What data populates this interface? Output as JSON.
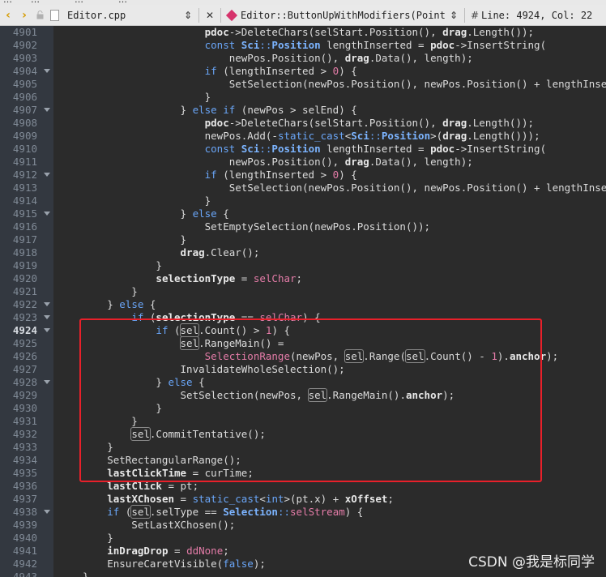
{
  "menubar": {
    "items": [
      "…",
      "…",
      "…",
      "…"
    ]
  },
  "toolbar": {
    "back_icon": "chevron-left-icon",
    "forward_icon": "chevron-right-icon",
    "file_name": "Editor.cpp",
    "file_switch_glyph": "⇕",
    "close_glyph": "✕",
    "function_name": "Editor::ButtonUpWithModifiers(Point, u",
    "function_switch_glyph": "⇕",
    "hash_glyph": "#",
    "line_info": "Line: 4924, Col: 22"
  },
  "colors": {
    "background": "#2b2b2b",
    "gutter": "#333840",
    "keyword": "#6aa6f8",
    "number": "#e47ca8",
    "annotation_box": "#e8202a"
  },
  "editor": {
    "current_line": "4924",
    "lines": [
      {
        "n": "4901",
        "fold": false,
        "t": [
          [
            "                        ",
            ""
          ],
          [
            "pdoc",
            "mb"
          ],
          [
            "->DeleteChars(selStart.Position(), ",
            ""
          ],
          [
            "drag",
            "mb"
          ],
          [
            ".Length());",
            ""
          ]
        ]
      },
      {
        "n": "4902",
        "fold": false,
        "t": [
          [
            "                        ",
            ""
          ],
          [
            "const ",
            "kw"
          ],
          [
            "Sci",
            "ty"
          ],
          [
            "::",
            "kw"
          ],
          [
            "Position",
            "ty"
          ],
          [
            " lengthInserted = ",
            ""
          ],
          [
            "pdoc",
            "mb"
          ],
          [
            "->InsertString(",
            ""
          ]
        ]
      },
      {
        "n": "4903",
        "fold": false,
        "t": [
          [
            "                            newPos.Position(), ",
            ""
          ],
          [
            "drag",
            "mb"
          ],
          [
            ".Data(), length);",
            ""
          ]
        ]
      },
      {
        "n": "4904",
        "fold": true,
        "t": [
          [
            "                        ",
            ""
          ],
          [
            "if ",
            "kw"
          ],
          [
            "(lengthInserted > ",
            ""
          ],
          [
            "0",
            "nu"
          ],
          [
            ") {",
            ""
          ]
        ]
      },
      {
        "n": "4905",
        "fold": false,
        "t": [
          [
            "                            SetSelection(newPos.Position(), newPos.Position() + lengthInserted);",
            ""
          ]
        ]
      },
      {
        "n": "4906",
        "fold": false,
        "t": [
          [
            "                        }",
            ""
          ]
        ]
      },
      {
        "n": "4907",
        "fold": true,
        "t": [
          [
            "                    } ",
            ""
          ],
          [
            "else if ",
            "kw"
          ],
          [
            "(newPos > selEnd) {",
            ""
          ]
        ]
      },
      {
        "n": "4908",
        "fold": false,
        "t": [
          [
            "                        ",
            ""
          ],
          [
            "pdoc",
            "mb"
          ],
          [
            "->DeleteChars(selStart.Position(), ",
            ""
          ],
          [
            "drag",
            "mb"
          ],
          [
            ".Length());",
            ""
          ]
        ]
      },
      {
        "n": "4909",
        "fold": false,
        "t": [
          [
            "                        newPos.Add(-",
            ""
          ],
          [
            "static_cast",
            "kw"
          ],
          [
            "<",
            ""
          ],
          [
            "Sci",
            "ty"
          ],
          [
            "::",
            "kw"
          ],
          [
            "Position",
            "ty"
          ],
          [
            ">(",
            ""
          ],
          [
            "drag",
            "mb"
          ],
          [
            ".Length()));",
            ""
          ]
        ]
      },
      {
        "n": "4910",
        "fold": false,
        "t": [
          [
            "                        ",
            ""
          ],
          [
            "const ",
            "kw"
          ],
          [
            "Sci",
            "ty"
          ],
          [
            "::",
            "kw"
          ],
          [
            "Position",
            "ty"
          ],
          [
            " lengthInserted = ",
            ""
          ],
          [
            "pdoc",
            "mb"
          ],
          [
            "->InsertString(",
            ""
          ]
        ]
      },
      {
        "n": "4911",
        "fold": false,
        "t": [
          [
            "                            newPos.Position(), ",
            ""
          ],
          [
            "drag",
            "mb"
          ],
          [
            ".Data(), length);",
            ""
          ]
        ]
      },
      {
        "n": "4912",
        "fold": true,
        "t": [
          [
            "                        ",
            ""
          ],
          [
            "if ",
            "kw"
          ],
          [
            "(lengthInserted > ",
            ""
          ],
          [
            "0",
            "nu"
          ],
          [
            ") {",
            ""
          ]
        ]
      },
      {
        "n": "4913",
        "fold": false,
        "t": [
          [
            "                            SetSelection(newPos.Position(), newPos.Position() + lengthInserted);",
            ""
          ]
        ]
      },
      {
        "n": "4914",
        "fold": false,
        "t": [
          [
            "                        }",
            ""
          ]
        ]
      },
      {
        "n": "4915",
        "fold": true,
        "t": [
          [
            "                    } ",
            ""
          ],
          [
            "else ",
            "kw"
          ],
          [
            "{",
            ""
          ]
        ]
      },
      {
        "n": "4916",
        "fold": false,
        "t": [
          [
            "                        SetEmptySelection(newPos.Position());",
            ""
          ]
        ]
      },
      {
        "n": "4917",
        "fold": false,
        "t": [
          [
            "                    }",
            ""
          ]
        ]
      },
      {
        "n": "4918",
        "fold": false,
        "t": [
          [
            "                    ",
            ""
          ],
          [
            "drag",
            "mb"
          ],
          [
            ".Clear();",
            ""
          ]
        ]
      },
      {
        "n": "4919",
        "fold": false,
        "t": [
          [
            "                }",
            ""
          ]
        ]
      },
      {
        "n": "4920",
        "fold": false,
        "t": [
          [
            "                ",
            ""
          ],
          [
            "selectionType",
            "mb"
          ],
          [
            " = ",
            ""
          ],
          [
            "selChar",
            "cs"
          ],
          [
            ";",
            ""
          ]
        ]
      },
      {
        "n": "4921",
        "fold": false,
        "t": [
          [
            "            }",
            ""
          ]
        ]
      },
      {
        "n": "4922",
        "fold": true,
        "t": [
          [
            "        } ",
            ""
          ],
          [
            "else ",
            "kw"
          ],
          [
            "{",
            ""
          ]
        ]
      },
      {
        "n": "4923",
        "fold": true,
        "t": [
          [
            "            ",
            ""
          ],
          [
            "if ",
            "kw"
          ],
          [
            "(",
            ""
          ],
          [
            "selectionType",
            "mb"
          ],
          [
            " == ",
            ""
          ],
          [
            "selChar",
            "cs"
          ],
          [
            ") {",
            ""
          ]
        ]
      },
      {
        "n": "4924",
        "fold": true,
        "t": [
          [
            "                ",
            ""
          ],
          [
            "if ",
            "kw"
          ],
          [
            "(",
            ""
          ],
          [
            "sel",
            "hl"
          ],
          [
            ".Count() > ",
            ""
          ],
          [
            "1",
            "nu"
          ],
          [
            ") {",
            ""
          ]
        ]
      },
      {
        "n": "4925",
        "fold": false,
        "t": [
          [
            "                    ",
            ""
          ],
          [
            "sel",
            "hl"
          ],
          [
            ".RangeMain() =",
            ""
          ]
        ]
      },
      {
        "n": "4926",
        "fold": false,
        "t": [
          [
            "                        ",
            ""
          ],
          [
            "SelectionRange",
            "cs"
          ],
          [
            "(newPos, ",
            ""
          ],
          [
            "sel",
            "hl"
          ],
          [
            ".Range(",
            ""
          ],
          [
            "sel",
            "hl"
          ],
          [
            ".Count() - ",
            ""
          ],
          [
            "1",
            "nu"
          ],
          [
            ").",
            ""
          ],
          [
            "anchor",
            "mb"
          ],
          [
            ");",
            ""
          ]
        ]
      },
      {
        "n": "4927",
        "fold": false,
        "t": [
          [
            "                    InvalidateWholeSelection();",
            ""
          ]
        ]
      },
      {
        "n": "4928",
        "fold": true,
        "t": [
          [
            "                } ",
            ""
          ],
          [
            "else ",
            "kw"
          ],
          [
            "{",
            ""
          ]
        ]
      },
      {
        "n": "4929",
        "fold": false,
        "t": [
          [
            "                    SetSelection(newPos, ",
            ""
          ],
          [
            "sel",
            "hl"
          ],
          [
            ".RangeMain().",
            ""
          ],
          [
            "anchor",
            "mb"
          ],
          [
            ");",
            ""
          ]
        ]
      },
      {
        "n": "4930",
        "fold": false,
        "t": [
          [
            "                }",
            ""
          ]
        ]
      },
      {
        "n": "4931",
        "fold": false,
        "t": [
          [
            "            }",
            ""
          ]
        ]
      },
      {
        "n": "4932",
        "fold": false,
        "t": [
          [
            "            ",
            ""
          ],
          [
            "sel",
            "hl"
          ],
          [
            ".CommitTentative();",
            ""
          ]
        ]
      },
      {
        "n": "4933",
        "fold": false,
        "t": [
          [
            "        }",
            ""
          ]
        ]
      },
      {
        "n": "4934",
        "fold": false,
        "t": [
          [
            "        SetRectangularRange();",
            ""
          ]
        ]
      },
      {
        "n": "4935",
        "fold": false,
        "t": [
          [
            "        ",
            ""
          ],
          [
            "lastClickTime",
            "mb"
          ],
          [
            " = curTime;",
            ""
          ]
        ]
      },
      {
        "n": "4936",
        "fold": false,
        "t": [
          [
            "        ",
            ""
          ],
          [
            "lastClick",
            "mb"
          ],
          [
            " = pt;",
            ""
          ]
        ]
      },
      {
        "n": "4937",
        "fold": false,
        "t": [
          [
            "        ",
            ""
          ],
          [
            "lastXChosen",
            "mb"
          ],
          [
            " = ",
            ""
          ],
          [
            "static_cast",
            "kw"
          ],
          [
            "<",
            ""
          ],
          [
            "int",
            "kw"
          ],
          [
            ">(pt.x) + ",
            ""
          ],
          [
            "xOffset",
            "mb"
          ],
          [
            ";",
            ""
          ]
        ]
      },
      {
        "n": "4938",
        "fold": true,
        "t": [
          [
            "        ",
            ""
          ],
          [
            "if ",
            "kw"
          ],
          [
            "(",
            ""
          ],
          [
            "sel",
            "hl"
          ],
          [
            ".selType == ",
            ""
          ],
          [
            "Selection",
            "ty"
          ],
          [
            "::",
            "kw"
          ],
          [
            "selStream",
            "cs"
          ],
          [
            ") {",
            ""
          ]
        ]
      },
      {
        "n": "4939",
        "fold": false,
        "t": [
          [
            "            SetLastXChosen();",
            ""
          ]
        ]
      },
      {
        "n": "4940",
        "fold": false,
        "t": [
          [
            "        }",
            ""
          ]
        ]
      },
      {
        "n": "4941",
        "fold": false,
        "t": [
          [
            "        ",
            ""
          ],
          [
            "inDragDrop",
            "mb"
          ],
          [
            " = ",
            ""
          ],
          [
            "ddNone",
            "cs"
          ],
          [
            ";",
            ""
          ]
        ]
      },
      {
        "n": "4942",
        "fold": false,
        "t": [
          [
            "        EnsureCaretVisible(",
            ""
          ],
          [
            "false",
            "kw"
          ],
          [
            ");",
            ""
          ]
        ]
      },
      {
        "n": "4943",
        "fold": false,
        "t": [
          [
            "    }",
            ""
          ]
        ]
      }
    ]
  },
  "watermark": "CSDN @我是标同学"
}
